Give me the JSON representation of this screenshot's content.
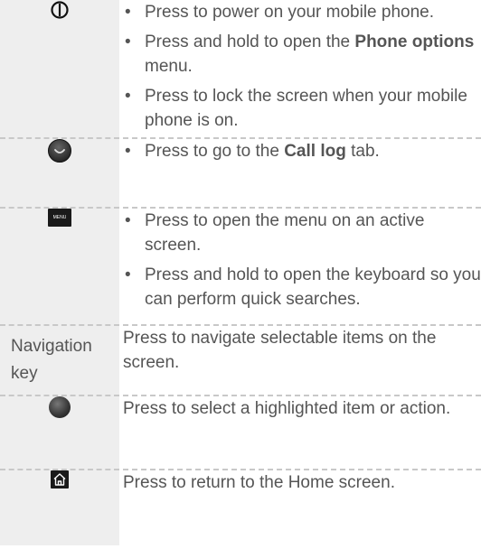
{
  "rows": [
    {
      "key_icon": "power-icon",
      "bullets": [
        [
          "Press to power on your mobile phone."
        ],
        [
          "Press and hold to open the ",
          {
            "b": "Phone options"
          },
          " menu."
        ],
        [
          "Press to lock the screen when your mobile phone is on."
        ]
      ]
    },
    {
      "key_icon": "call-log-key-icon",
      "bullets": [
        [
          "Press to go to the ",
          {
            "b": "Call log"
          },
          " tab."
        ]
      ]
    },
    {
      "key_icon": "menu-key-icon",
      "key_icon_text": "MENU",
      "bullets": [
        [
          "Press to open the menu on an active screen."
        ],
        [
          "Press and hold to open the keyboard so you can perform quick searches."
        ]
      ]
    },
    {
      "key_label": "Navigation key",
      "desc": "Press to navigate selectable items on the screen."
    },
    {
      "key_icon": "trackball-icon",
      "desc": "Press to select a highlighted item or action."
    },
    {
      "key_icon": "home-key-icon",
      "desc": "Press to return to the Home screen."
    }
  ]
}
